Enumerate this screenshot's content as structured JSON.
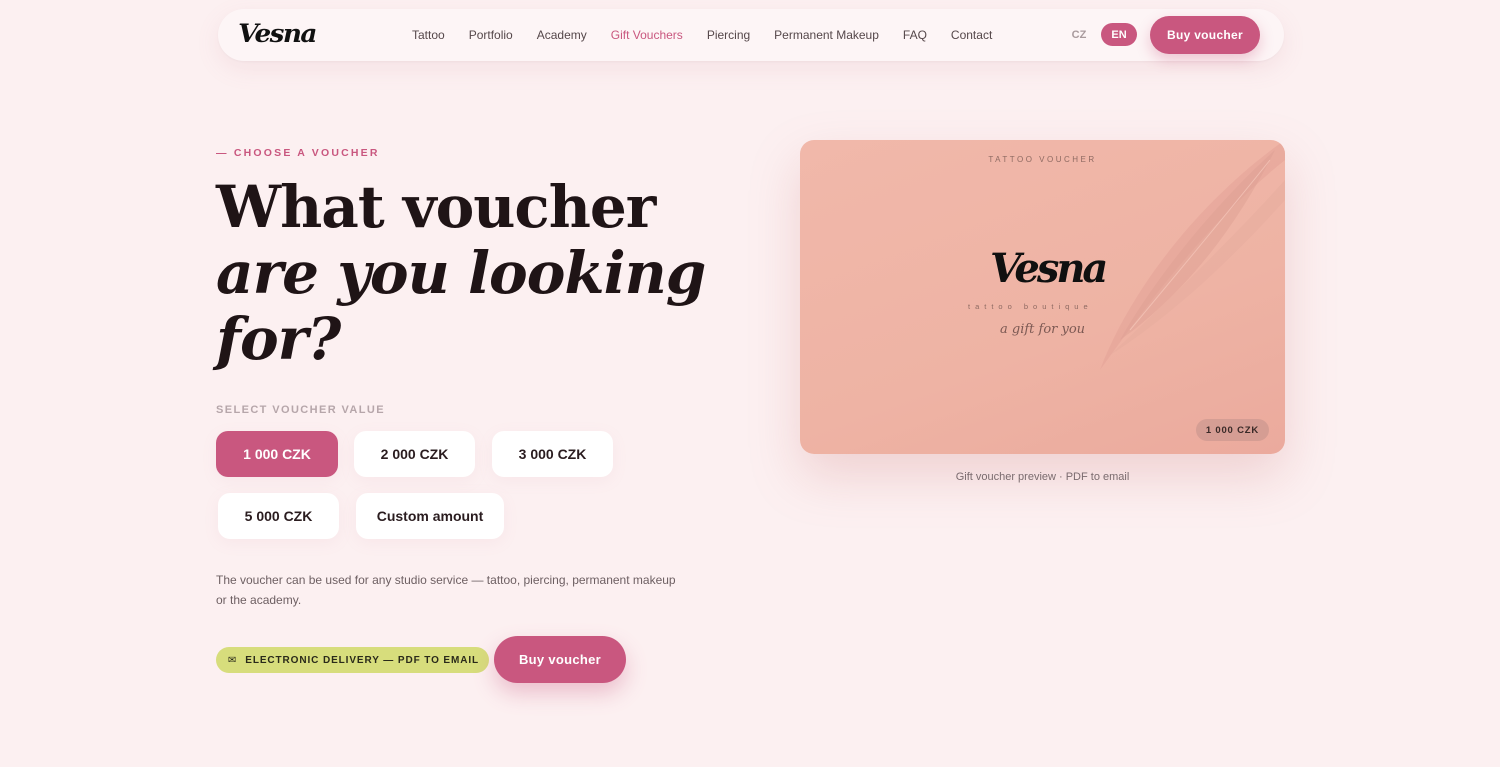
{
  "nav": {
    "logo": "Vesna",
    "links": [
      {
        "label": "Tattoo"
      },
      {
        "label": "Portfolio"
      },
      {
        "label": "Academy"
      },
      {
        "label": "Gift Vouchers",
        "active": true
      },
      {
        "label": "Piercing"
      },
      {
        "label": "Permanent Makeup"
      },
      {
        "label": "FAQ"
      },
      {
        "label": "Contact"
      }
    ],
    "languages": [
      "CZ",
      "EN"
    ],
    "active_language": "EN",
    "buy_label": "Buy voucher"
  },
  "hero": {
    "eyebrow": "— CHOOSE A VOUCHER",
    "headline_line1": "What voucher",
    "headline_line2": "are you looking",
    "headline_line3": "for?"
  },
  "values": {
    "label": "SELECT VOUCHER VALUE",
    "options": [
      "1 000 CZK",
      "2 000 CZK",
      "3 000 CZK",
      "5 000 CZK",
      "Custom amount"
    ],
    "selected": "1 000 CZK"
  },
  "description": "The voucher can be used for any studio service — tattoo, piercing, permanent makeup or the academy.",
  "delivery": {
    "icon": "mail-icon",
    "icon_glyph": "✉",
    "label": "ELECTRONIC DELIVERY — PDF TO EMAIL"
  },
  "cta": {
    "buy_label": "Buy voucher"
  },
  "card": {
    "eyebrow": "TATTOO VOUCHER",
    "logo": "Vesna",
    "subtitle": "tattoo boutique",
    "tagline": "a gift for you",
    "amount": "1 000 CZK",
    "caption": "Gift voucher preview · PDF to email"
  },
  "colors": {
    "accent": "#c9577f",
    "background": "#fcf0f1",
    "card": "#eeb3a4",
    "delivery_badge": "#d7dd7c"
  }
}
